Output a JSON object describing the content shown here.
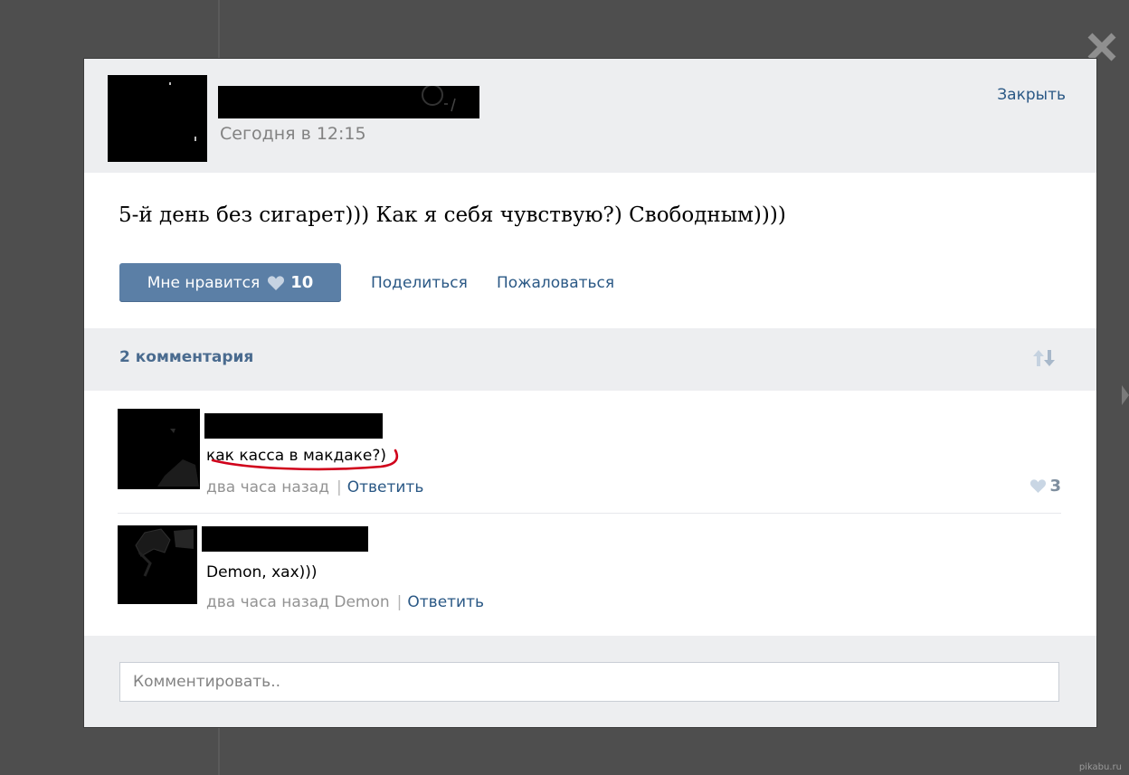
{
  "post": {
    "time": "Сегодня в 12:15",
    "close_label": "Закрыть",
    "text": "5-й день без сигарет))) Как я себя чувствую?) Свободным))))",
    "like_label": "Мне нравится",
    "like_count": "10",
    "share_label": "Поделиться",
    "report_label": "Пожаловаться"
  },
  "comments_header": {
    "count_label": "2 комментария"
  },
  "comments": [
    {
      "text": "как касса в макдаке?)",
      "time": "два часа назад",
      "reply_label": "Ответить",
      "likes": "3"
    },
    {
      "text": "Demon, хах)))",
      "time": "два часа назад Demon",
      "reply_label": "Ответить"
    }
  ],
  "composer": {
    "placeholder": "Комментировать.."
  },
  "watermark": "pikabu.ru",
  "colors": {
    "overlay": "#4e4e4e",
    "header_bg": "#edeef0",
    "link": "#2a5885",
    "like_button": "#5b7fa6",
    "annotation": "#d0021b"
  }
}
